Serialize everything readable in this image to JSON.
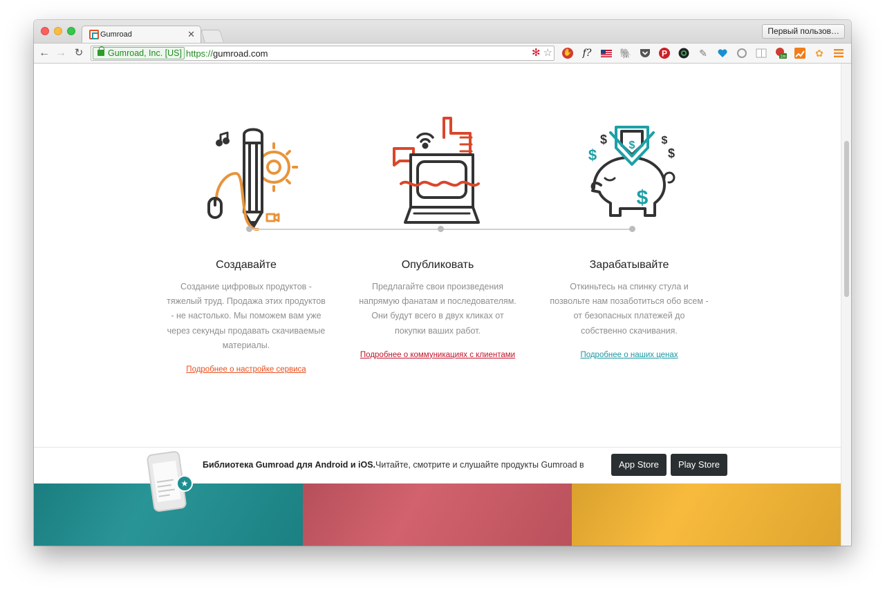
{
  "browser": {
    "tab_title": "Gumroad",
    "profile_button": "Первый пользов…",
    "ev_badge": "Gumroad, Inc. [US]",
    "url_scheme": "https://",
    "url_host": "gumroad.com"
  },
  "colors": {
    "orange": "#e8943a",
    "red": "#d9472b",
    "teal": "#1da0a6",
    "dark": "#333333",
    "link_create": "#e94e1b",
    "link_publish": "#c0142a",
    "link_earn": "#1a98a3"
  },
  "features": [
    {
      "title": "Создавайте",
      "text": "Создание цифровых продуктов - тяжелый труд. Продажа этих продуктов - не настолько. Мы поможем вам уже через секунды продавать скачиваемые материалы.",
      "link": "Подробнее о настройке сервиса"
    },
    {
      "title": "Опубликовать",
      "text": "Предлагайте свои произведения напрямую фанатам и последователям. Они будут всего в двух кликах от покупки ваших работ.",
      "link": "Подробнее о коммуникациях с клиентами"
    },
    {
      "title": "Зарабатывайте",
      "text": "Откиньтесь на спинку стула и позвольте нам позаботиться обо всем - от безопасных платежей до собственно скачивания.",
      "link": "Подробнее о наших ценах"
    }
  ],
  "banner": {
    "title": "Библиотека Gumroad для Android и iOS.",
    "text": "Читайте, смотрите и слушайте продукты Gumroad в",
    "app_store": "App Store",
    "play_store": "Play Store"
  },
  "panels": [
    {
      "color": "#1e8f91"
    },
    {
      "color": "#cf5a66"
    },
    {
      "color": "#f7b733"
    }
  ]
}
